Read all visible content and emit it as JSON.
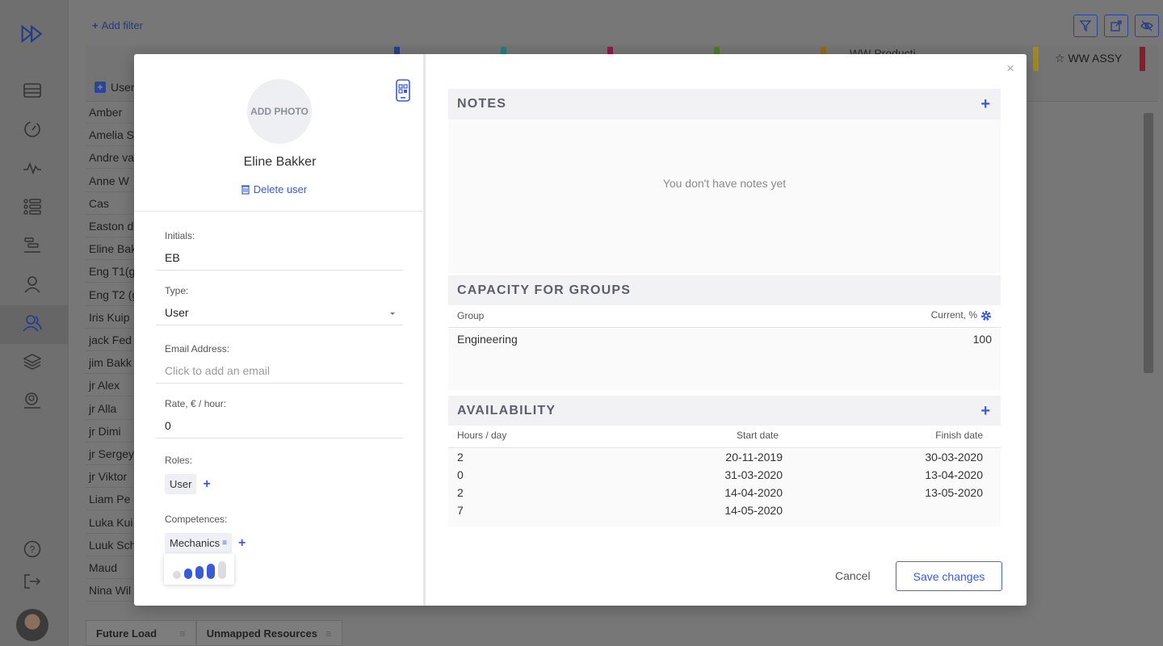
{
  "background": {
    "add_filter": "Add filter",
    "user_column": "User",
    "users": [
      "Amber",
      "Amelia S",
      "Andre va",
      "Anne W",
      "Cas",
      "Easton d",
      "Eline Bak",
      "Eng T1(g",
      "Eng T2 (g",
      "Iris Kuip",
      "jack Fed",
      "jim Bakk",
      "jr Alex",
      "jr Alla",
      "jr Dimi",
      "jr Sergey",
      "jr Viktor",
      "Liam Pe",
      "Luka Kui",
      "Luuk Sch",
      "Maud",
      "Nina Wil"
    ],
    "column_ww_production": "WW Producti",
    "column_ww_assy": "WW ASSY",
    "tabs": [
      "Future Load",
      "Unmapped Resources"
    ]
  },
  "profile": {
    "add_photo": "ADD PHOTO",
    "name": "Eline Bakker",
    "delete_user": "Delete user",
    "initials_label": "Initials:",
    "initials_value": "EB",
    "type_label": "Type:",
    "type_value": "User",
    "email_label": "Email Address:",
    "email_placeholder": "Click to add an email",
    "rate_label": "Rate, € / hour:",
    "rate_value": "0",
    "roles_label": "Roles:",
    "roles": [
      "User"
    ],
    "competences_label": "Competences:",
    "competences": [
      "Mechanics"
    ],
    "competence_level": 4,
    "competence_level_max": 5
  },
  "notes": {
    "title": "NOTES",
    "empty": "You don't have notes yet"
  },
  "capacity": {
    "title": "CAPACITY FOR GROUPS",
    "col_group": "Group",
    "col_current": "Current, %",
    "rows": [
      {
        "group": "Engineering",
        "current": "100"
      }
    ]
  },
  "availability": {
    "title": "AVAILABILITY",
    "col_hours": "Hours / day",
    "col_start": "Start date",
    "col_finish": "Finish date",
    "rows": [
      {
        "hours": "2",
        "start": "20-11-2019",
        "finish": "30-03-2020"
      },
      {
        "hours": "0",
        "start": "31-03-2020",
        "finish": "13-04-2020"
      },
      {
        "hours": "2",
        "start": "14-04-2020",
        "finish": "13-05-2020"
      },
      {
        "hours": "7",
        "start": "14-05-2020",
        "finish": ""
      }
    ]
  },
  "actions": {
    "cancel": "Cancel",
    "save": "Save changes"
  },
  "colors": {
    "accent": "#3b5bd6",
    "overlay": "#777777"
  }
}
